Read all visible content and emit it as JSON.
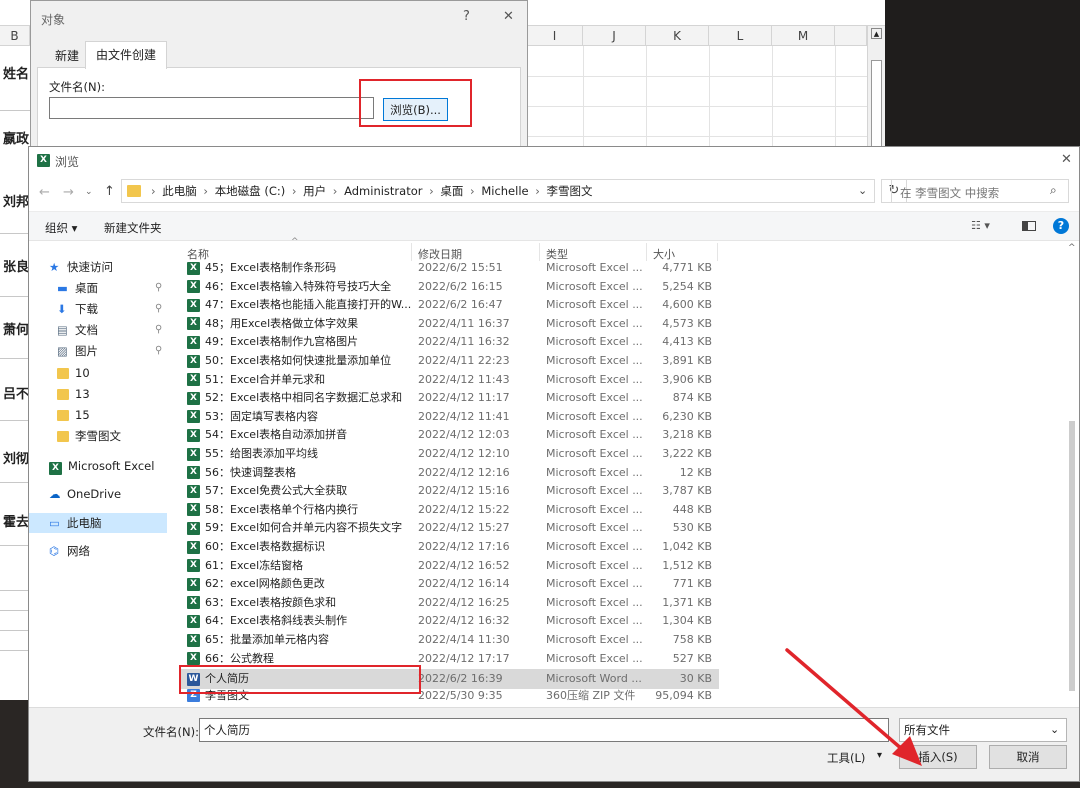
{
  "excel": {
    "columns": [
      "B",
      "I",
      "J",
      "K",
      "L",
      "M"
    ],
    "names": [
      "姓名",
      "嬴政",
      "刘邦",
      "张良",
      "萧何",
      "吕不韦",
      "刘彻",
      "霍去病"
    ]
  },
  "object_dialog": {
    "title": "对象",
    "help": "?",
    "close": "✕",
    "tabs": [
      "新建",
      "由文件创建"
    ],
    "filename_label": "文件名(N):",
    "filename_value": "",
    "browse_button": "浏览(B)..."
  },
  "browse": {
    "title": "浏览",
    "close": "✕",
    "breadcrumb": [
      "此电脑",
      "本地磁盘 (C:)",
      "用户",
      "Administrator",
      "桌面",
      "Michelle",
      "李雪图文"
    ],
    "search_placeholder": "在 李雪图文 中搜索",
    "toolbar": {
      "organize": "组织 ▾",
      "new_folder": "新建文件夹"
    },
    "nav": [
      {
        "label": "快速访问",
        "icon": "star-icon",
        "pin": false
      },
      {
        "label": "桌面",
        "icon": "desktop-icon",
        "pin": true
      },
      {
        "label": "下载",
        "icon": "download-icon",
        "pin": true
      },
      {
        "label": "文档",
        "icon": "document-icon",
        "pin": true
      },
      {
        "label": "图片",
        "icon": "pictures-icon",
        "pin": true
      },
      {
        "label": "10",
        "icon": "folder-icon",
        "pin": false
      },
      {
        "label": "13",
        "icon": "folder-icon",
        "pin": false
      },
      {
        "label": "15",
        "icon": "folder-icon",
        "pin": false
      },
      {
        "label": "李雪图文",
        "icon": "folder-icon",
        "pin": false
      },
      {
        "label": "Microsoft Excel",
        "icon": "excel-icon",
        "pin": false
      },
      {
        "label": "OneDrive",
        "icon": "cloud-icon",
        "pin": false
      },
      {
        "label": "此电脑",
        "icon": "computer-icon",
        "pin": false
      },
      {
        "label": "网络",
        "icon": "network-icon",
        "pin": false
      }
    ],
    "columns": [
      "名称",
      "修改日期",
      "类型",
      "大小"
    ],
    "files": [
      {
        "name": "45；Excel表格制作条形码",
        "date": "2022/6/2 15:51",
        "type": "Microsoft Excel ...",
        "size": "4,771 KB",
        "kind": "xl"
      },
      {
        "name": "46：Excel表格输入特殊符号技巧大全",
        "date": "2022/6/2 16:15",
        "type": "Microsoft Excel ...",
        "size": "5,254 KB",
        "kind": "xl"
      },
      {
        "name": "47：Excel表格也能插入能直接打开的W...",
        "date": "2022/6/2 16:47",
        "type": "Microsoft Excel ...",
        "size": "4,600 KB",
        "kind": "xl"
      },
      {
        "name": "48；用Excel表格做立体字效果",
        "date": "2022/4/11 16:37",
        "type": "Microsoft Excel ...",
        "size": "4,573 KB",
        "kind": "xl"
      },
      {
        "name": "49：Excel表格制作九宫格图片",
        "date": "2022/4/11 16:32",
        "type": "Microsoft Excel ...",
        "size": "4,413 KB",
        "kind": "xl"
      },
      {
        "name": "50：Excel表格如何快速批量添加单位",
        "date": "2022/4/11 22:23",
        "type": "Microsoft Excel ...",
        "size": "3,891 KB",
        "kind": "xl"
      },
      {
        "name": "51：Excel合并单元求和",
        "date": "2022/4/12 11:43",
        "type": "Microsoft Excel ...",
        "size": "3,906 KB",
        "kind": "xl"
      },
      {
        "name": "52：Excel表格中相同名字数据汇总求和",
        "date": "2022/4/12 11:17",
        "type": "Microsoft Excel ...",
        "size": "874 KB",
        "kind": "xl"
      },
      {
        "name": "53：固定填写表格内容",
        "date": "2022/4/12 11:41",
        "type": "Microsoft Excel ...",
        "size": "6,230 KB",
        "kind": "xl"
      },
      {
        "name": "54：Excel表格自动添加拼音",
        "date": "2022/4/12 12:03",
        "type": "Microsoft Excel ...",
        "size": "3,218 KB",
        "kind": "xl"
      },
      {
        "name": "55：给图表添加平均线",
        "date": "2022/4/12 12:10",
        "type": "Microsoft Excel ...",
        "size": "3,222 KB",
        "kind": "xl"
      },
      {
        "name": "56：快速调整表格",
        "date": "2022/4/12 12:16",
        "type": "Microsoft Excel ...",
        "size": "12 KB",
        "kind": "xl"
      },
      {
        "name": "57：Excel免费公式大全获取",
        "date": "2022/4/12 15:16",
        "type": "Microsoft Excel ...",
        "size": "3,787 KB",
        "kind": "xl"
      },
      {
        "name": "58：Excel表格单个行格内换行",
        "date": "2022/4/12 15:22",
        "type": "Microsoft Excel ...",
        "size": "448 KB",
        "kind": "xl"
      },
      {
        "name": "59：Excel如何合并单元内容不损失文字",
        "date": "2022/4/12 15:27",
        "type": "Microsoft Excel ...",
        "size": "530 KB",
        "kind": "xl"
      },
      {
        "name": "60：Excel表格数据标识",
        "date": "2022/4/12 17:16",
        "type": "Microsoft Excel ...",
        "size": "1,042 KB",
        "kind": "xl"
      },
      {
        "name": "61：Excel冻结窗格",
        "date": "2022/4/12 16:52",
        "type": "Microsoft Excel ...",
        "size": "1,512 KB",
        "kind": "xl"
      },
      {
        "name": "62：excel网格颜色更改",
        "date": "2022/4/12 16:14",
        "type": "Microsoft Excel ...",
        "size": "771 KB",
        "kind": "xl"
      },
      {
        "name": "63：Excel表格按颜色求和",
        "date": "2022/4/12 16:25",
        "type": "Microsoft Excel ...",
        "size": "1,371 KB",
        "kind": "xl"
      },
      {
        "name": "64：Excel表格斜线表头制作",
        "date": "2022/4/12 16:32",
        "type": "Microsoft Excel ...",
        "size": "1,304 KB",
        "kind": "xl"
      },
      {
        "name": "65：批量添加单元格内容",
        "date": "2022/4/14 11:30",
        "type": "Microsoft Excel ...",
        "size": "758 KB",
        "kind": "xl"
      },
      {
        "name": "66：公式教程",
        "date": "2022/4/12 17:17",
        "type": "Microsoft Excel ...",
        "size": "527 KB",
        "kind": "xl"
      },
      {
        "name": "个人简历",
        "date": "2022/6/2 16:39",
        "type": "Microsoft Word ...",
        "size": "30 KB",
        "kind": "wd"
      },
      {
        "name": "李雪图文",
        "date": "2022/5/30 9:35",
        "type": "360压缩 ZIP 文件",
        "size": "95,094 KB",
        "kind": "zip"
      }
    ],
    "filename_label": "文件名(N):",
    "filename_value": "个人简历",
    "filter_value": "所有文件",
    "tools_label": "工具(L)",
    "insert_button": "插入(S)",
    "cancel_button": "取消"
  },
  "colors": {
    "highlight": "#e0252b",
    "selected_row": "#d9d9d9",
    "excel_green": "#1e7145",
    "link_blue": "#0078d7"
  }
}
